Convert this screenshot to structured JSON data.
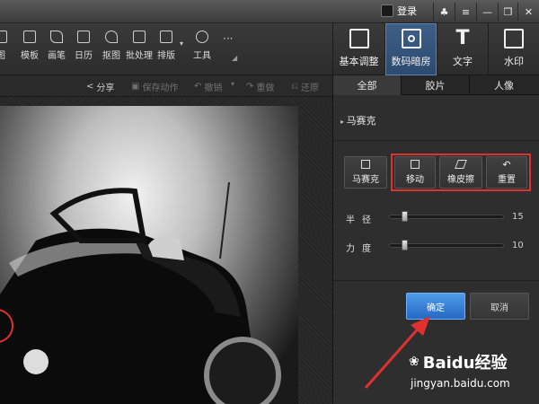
{
  "titlebar": {
    "login": "登录"
  },
  "toolbar": {
    "tools": [
      {
        "label": "图",
        "icon": "image-icon"
      },
      {
        "label": "模板",
        "icon": "template-icon"
      },
      {
        "label": "画笔",
        "icon": "brush-icon"
      },
      {
        "label": "日历",
        "icon": "calendar-icon"
      },
      {
        "label": "抠图",
        "icon": "cutout-icon"
      },
      {
        "label": "批处理",
        "icon": "batch-icon"
      },
      {
        "label": "排版",
        "icon": "layout-icon"
      },
      {
        "label": "工具",
        "icon": "wrench-icon"
      }
    ]
  },
  "panel_tabs": [
    {
      "label": "基本调整",
      "icon": "adjust-icon"
    },
    {
      "label": "数码暗房",
      "icon": "camera-icon"
    },
    {
      "label": "文字",
      "icon": "text-icon"
    },
    {
      "label": "水印",
      "icon": "watermark-icon"
    }
  ],
  "actions": {
    "share": "分享",
    "save_action": "保存动作",
    "undo": "撤销",
    "redo": "重做",
    "restore": "还原"
  },
  "sub_tabs": [
    "全部",
    "胶片",
    "人像"
  ],
  "section": {
    "title": "马赛克"
  },
  "mosaic": {
    "main": "马赛克",
    "move": "移动",
    "eraser": "橡皮擦",
    "reset": "重置"
  },
  "sliders": [
    {
      "label": "半径",
      "value": "15",
      "level": 0.08
    },
    {
      "label": "力度",
      "value": "10",
      "level": 0.08
    }
  ],
  "buttons": {
    "confirm": "确定",
    "cancel": "取消"
  },
  "watermark": {
    "brand": "Baidu经验",
    "url": "jingyan.baidu.com"
  },
  "colors": {
    "accent": "#2f7ad1",
    "highlight": "#e03030"
  }
}
